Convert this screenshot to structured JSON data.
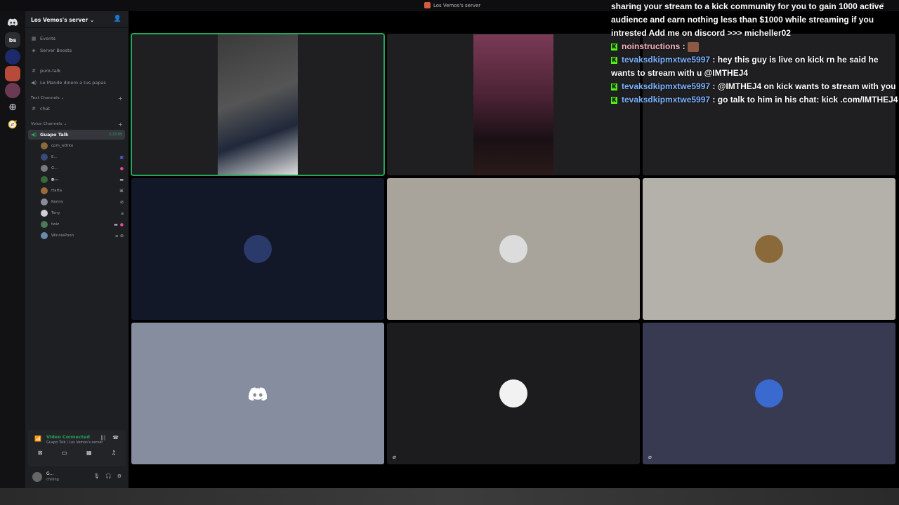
{
  "window": {
    "title": "Los Vemos's server"
  },
  "guilds": {
    "current_initials": "bs"
  },
  "server": {
    "name": "Los Vemos's server ⌄"
  },
  "sidebar": {
    "top_items": [
      {
        "label": "Events",
        "icon": "calendar-icon"
      },
      {
        "label": "Server Boosts",
        "icon": "boost-icon"
      }
    ],
    "loose_channels": [
      {
        "label": "puro-talk",
        "icon": "#"
      },
      {
        "label": "Le Mande dinero a tus papas",
        "icon": "speaker-icon"
      }
    ],
    "text_category": "Text Channels ⌄",
    "text_channels": [
      {
        "label": "chat"
      }
    ],
    "voice_category": "Voice Channels ⌄",
    "voice_channel": {
      "label": "Guapo Talk",
      "timer": "3:13:05"
    },
    "voice_users": [
      {
        "name": "cpm_w3rko",
        "color": "#8a6a3a"
      },
      {
        "name": "E...",
        "color": "#3a4a7a"
      },
      {
        "name": "G...",
        "color": "#7a7a7a"
      },
      {
        "name": "g...",
        "color": "#3a6a3a"
      },
      {
        "name": "HaHa",
        "color": "#9a6a3a"
      },
      {
        "name": "Kenny",
        "color": "#8a8a9a"
      },
      {
        "name": "Tony",
        "color": "#d0d0d0"
      },
      {
        "name": "twiz",
        "color": "#4a7a5a"
      },
      {
        "name": "WinniePooh",
        "color": "#6a8aaa"
      }
    ]
  },
  "voice_panel": {
    "status": "Video Connected",
    "sub": "Guapo Talk / Los Vemos's server"
  },
  "user_panel": {
    "name": "G...",
    "status": "chilling"
  },
  "chat": {
    "first_line": "sharing your stream to a kick community for you to gain 1000 active audience and earn nothing less than $1000 while streaming if you intrested Add me on discord >>> micheller02",
    "messages": [
      {
        "user": "noinstructions",
        "text": " : "
      },
      {
        "user": "tevaksdkipmxtwe5997",
        "text": " : hey this guy is live on kick rn he said he wants to stream with u @IMTHEJ4"
      },
      {
        "user": "tevaksdkipmxtwe5997",
        "text": " : @IMTHEJ4 on kick wants to stream with you"
      },
      {
        "user": "tevaksdkipmxtwe5997",
        "text": " : go talk to him in his chat: kick .com/IMTHEJ4"
      }
    ]
  },
  "tiles": [
    {
      "kind": "video",
      "bg": "#1f1f21"
    },
    {
      "kind": "video",
      "bg": "#1f1f21"
    },
    {
      "kind": "empty",
      "bg": "#1f1f21"
    },
    {
      "kind": "avatar",
      "bg": "#121827",
      "avatar_color": "#2a3a6a"
    },
    {
      "kind": "avatar",
      "bg": "#a8a49c",
      "avatar_color": "#dcdcdc"
    },
    {
      "kind": "avatar",
      "bg": "#b4b0aa",
      "avatar_color": "#8a6a3a"
    },
    {
      "kind": "avatar",
      "bg": "#868d9e",
      "avatar_color": "#868d9e"
    },
    {
      "kind": "avatar",
      "bg": "#1c1c1e",
      "avatar_color": "#f2f2f2"
    },
    {
      "kind": "avatar",
      "bg": "#383a52",
      "avatar_color": "#3a6acf"
    }
  ]
}
